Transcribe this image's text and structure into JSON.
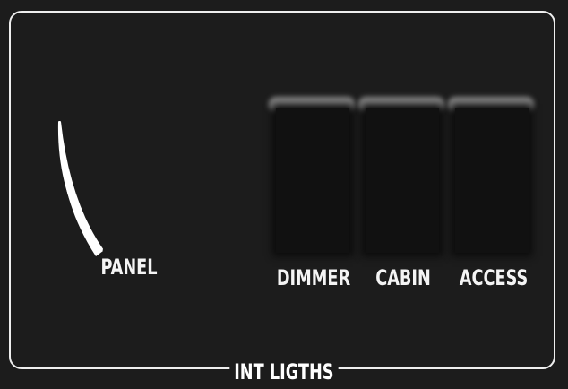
{
  "panel": {
    "title": "INT LIGTHS",
    "knob_label": "PANEL"
  },
  "switches": [
    {
      "label": "DIMMER"
    },
    {
      "label": "CABIN"
    },
    {
      "label": "ACCESS"
    }
  ],
  "colors": {
    "background": "#1c1c1c",
    "border": "#eeeeee",
    "text": "#ffffff",
    "switch_body": "#111111",
    "switch_cap_glow": "#8a8a8a"
  },
  "icons": {
    "knob_pointer": "curved-pointer-icon"
  }
}
